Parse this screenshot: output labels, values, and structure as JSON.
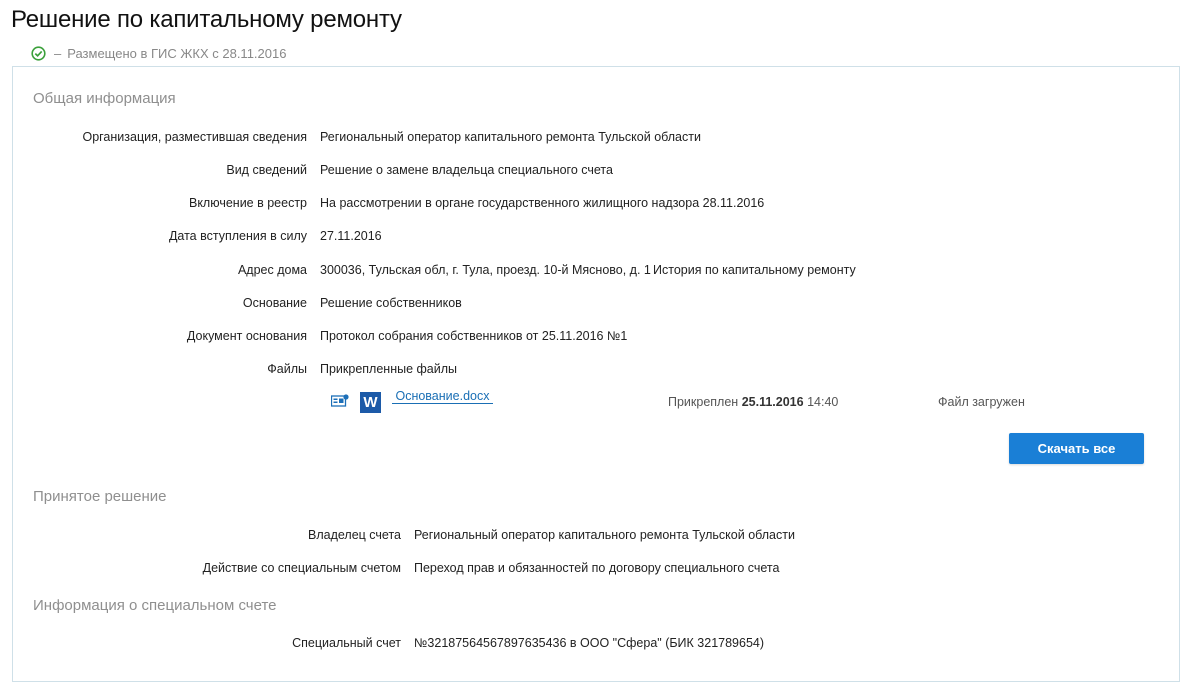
{
  "page": {
    "title": "Решение по капитальному ремонту",
    "status_dash": "–",
    "status_text": "Размещено в ГИС ЖКХ с 28.11.2016"
  },
  "general": {
    "title": "Общая информация",
    "org_label": "Организация, разместившая сведения",
    "org_value": "Региональный оператор капитального ремонта Тульской области",
    "type_label": "Вид сведений",
    "type_value": "Решение о замене владельца специального счета",
    "registry_label": "Включение в реестр",
    "registry_value": "На рассмотрении в органе государственного жилищного надзора 28.11.2016",
    "date_label": "Дата вступления в силу",
    "date_value": "27.11.2016",
    "address_label": "Адрес дома",
    "address_value": "300036, Тульская обл, г. Тула, проезд. 10-й Мясново, д. 1",
    "address_link": "История по капитальному ремонту",
    "basis_label": "Основание",
    "basis_value": "Решение собственников",
    "doc_label": "Документ основания",
    "doc_value": "Протокол собрания собственников от 25.11.2016 №1",
    "files_label": "Файлы",
    "files_value": "Прикрепленные файлы",
    "file": {
      "icon": "W",
      "name": " Основание.docx ",
      "attached_prefix": "Прикреплен",
      "attached_date": "25.11.2016",
      "attached_time": "14:40",
      "status": "Файл загружен"
    },
    "download_all": "Скачать все"
  },
  "decision": {
    "title": "Принятое решение",
    "owner_label": "Владелец счета",
    "owner_value": "Региональный оператор капитального ремонта Тульской области",
    "action_label": "Действие со специальным счетом",
    "action_value": "Переход прав и обязанностей по договору специального счета"
  },
  "account": {
    "title": "Информация о специальном счете",
    "special_label": "Специальный счет",
    "special_value": "№32187564567897635436 в ООО \"Сфера\" (БИК 321789654)"
  },
  "colors": {
    "link": "#1a6fb5",
    "button": "#1a7fd6",
    "status_icon": "#3aa03a",
    "panel_border": "#cfe0e8"
  }
}
